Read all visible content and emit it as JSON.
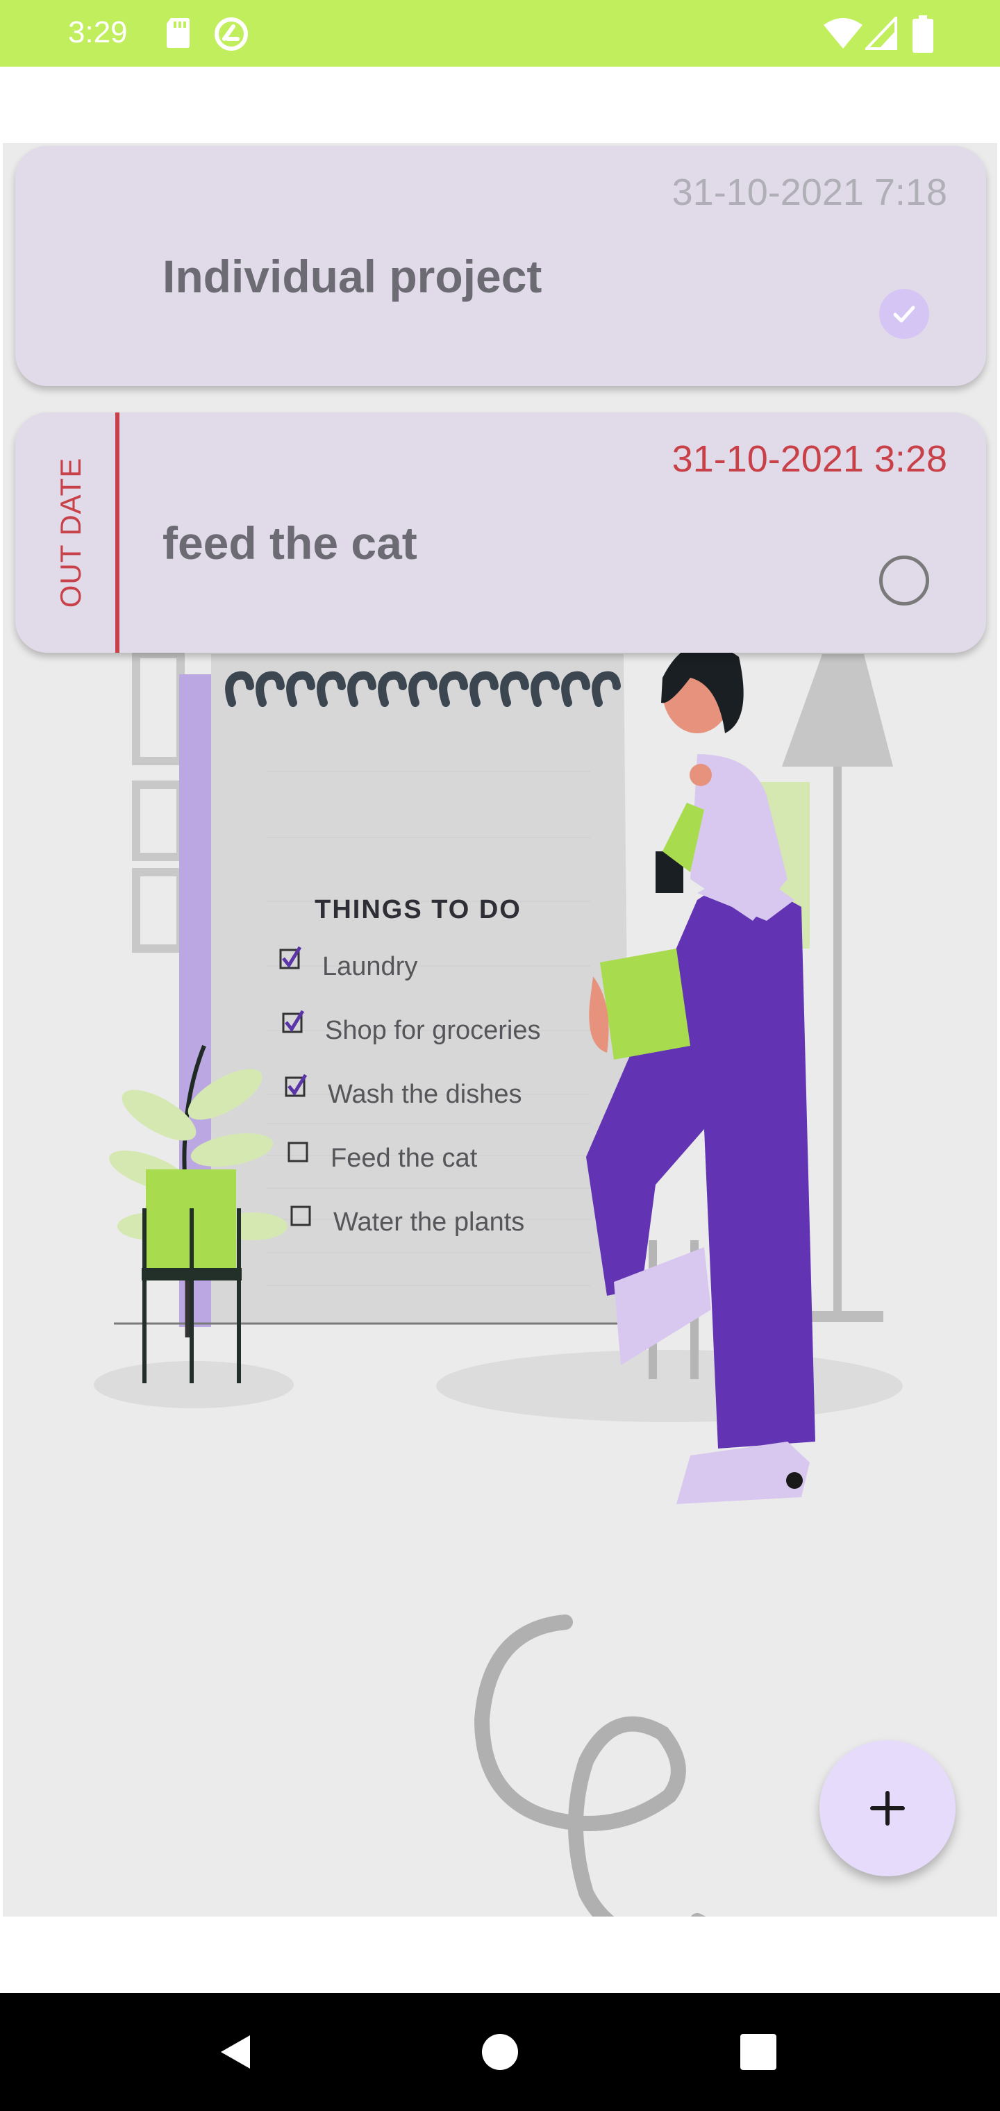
{
  "status_bar": {
    "time": "3:29",
    "icons": [
      "sd-card-icon",
      "sync-icon",
      "wifi-icon",
      "signal-icon",
      "battery-icon"
    ],
    "background": "#c1ee5c"
  },
  "tasks": [
    {
      "date": "31-10-2021 7:18",
      "title": "Individual project",
      "completed": true,
      "date_color": "#b0aeb6"
    },
    {
      "date": "31-10-2021 3:28",
      "title": "feed the cat",
      "completed": false,
      "overdue_label": "OUT DATE",
      "date_color": "#c84048"
    }
  ],
  "illustration": {
    "heading": "THINGS TO DO",
    "items": [
      {
        "text": "Laundry",
        "checked": true
      },
      {
        "text": "Shop for groceries",
        "checked": true
      },
      {
        "text": "Wash the dishes",
        "checked": true
      },
      {
        "text": "Feed the cat",
        "checked": false
      },
      {
        "text": "Water the plants",
        "checked": false
      }
    ]
  },
  "fab": {
    "icon": "plus-icon",
    "color": "#e6dbfb"
  },
  "nav_bar": {
    "icons": [
      "back-icon",
      "home-icon",
      "recents-icon"
    ]
  }
}
